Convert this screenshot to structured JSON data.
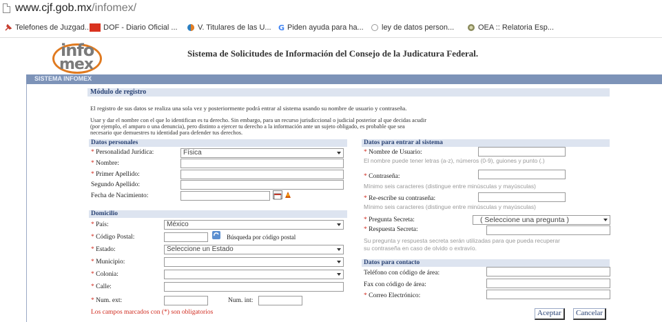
{
  "browser": {
    "url_host": "www.cjf.gob.mx",
    "url_path": "/infomex/",
    "bookmarks": [
      {
        "label": "Telefones de Juzgad...",
        "icon": "pin-icon"
      },
      {
        "label": "DOF - Diario Oficial ...",
        "icon": "dof-icon"
      },
      {
        "label": "V. Titulares de las U...",
        "icon": "globe-icon"
      },
      {
        "label": "Piden ayuda para ha...",
        "icon": "google-icon"
      },
      {
        "label": "ley de datos person...",
        "icon": "circle-icon"
      },
      {
        "label": "OEA :: Relatoria Esp...",
        "icon": "seal-icon"
      }
    ]
  },
  "header": {
    "logo_top": "info",
    "logo_bottom": "mex",
    "title": "Sistema de Solicitudes de Información del Consejo de la Judicatura Federal."
  },
  "appbar": {
    "label": "SISTEMA INFOMEX"
  },
  "form": {
    "section_title": "Módulo de registro",
    "intro1": "El registro de sus datos se realiza una sola vez y posteriormente podrá entrar al sistema usando su nombre de usuario y contraseña.",
    "intro2_l1": "Usar y dar el nombre con el que lo identifican es tu derecho. Sin embargo, para un recurso jurisdiccional o judicial posterior al que decidas acudir",
    "intro2_l2": "(por ejemplo, el amparo o una denuncia), pero distinto a ejercer tu derecho a la información ante un sujeto obligado, es probable que sea",
    "intro2_l3": "necesario que demuestres tu identidad para defender tus derechos.",
    "personal": {
      "title": "Datos personales",
      "personalidad_label": "Personalidad Jurídica:",
      "personalidad_value": "Física",
      "nombre_label": "Nombre:",
      "primer_label": "Primer Apellido:",
      "segundo_label": "Segundo Apellido:",
      "fecha_label": "Fecha de Nacimiento:"
    },
    "domicilio": {
      "title": "Domicilio",
      "pais_label": "País:",
      "pais_value": "México",
      "cp_label": "Código Postal:",
      "cp_search": "Búsqueda por código postal",
      "estado_label": "Estado:",
      "estado_value": "Seleccione un Estado",
      "municipio_label": "Municipio:",
      "colonia_label": "Colonia:",
      "calle_label": "Calle:",
      "num_ext_label": "Num. ext:",
      "num_int_label": "Num. int:"
    },
    "acceso": {
      "title": "Datos para entrar al sistema",
      "usuario_label": "Nombre de Usuario:",
      "usuario_hint": "El nombre puede tener letras (a-z), números (0-9), guiones y punto (.)",
      "pass_label": "Contraseña:",
      "pass_hint": "Mínimo seis caracteres (distingue entre minúsculas y mayúsculas)",
      "repass_label": "Re-escribe su contraseña:",
      "repass_hint": "Mínimo seis caracteres (distingue entre minúsculas y mayúsculas)",
      "pregunta_label": "Pregunta Secreta:",
      "pregunta_value": "( Seleccione una pregunta )",
      "respuesta_label": "Respuesta Secreta:",
      "secret_hint1": "Su pregunta y respuesta secreta serán utilizadas para que pueda recuperar",
      "secret_hint2": "su contraseña en caso de olvido o extravío."
    },
    "contacto": {
      "title": "Datos para contacto",
      "telefono_label": "Teléfono con código de área:",
      "fax_label": "Fax con código de área:",
      "correo_label": "Correo Electrónico:"
    },
    "required_note": "Los campos marcados con (*) son obligatorios",
    "accept_label": "Aceptar",
    "cancel_label": "Cancelar"
  }
}
